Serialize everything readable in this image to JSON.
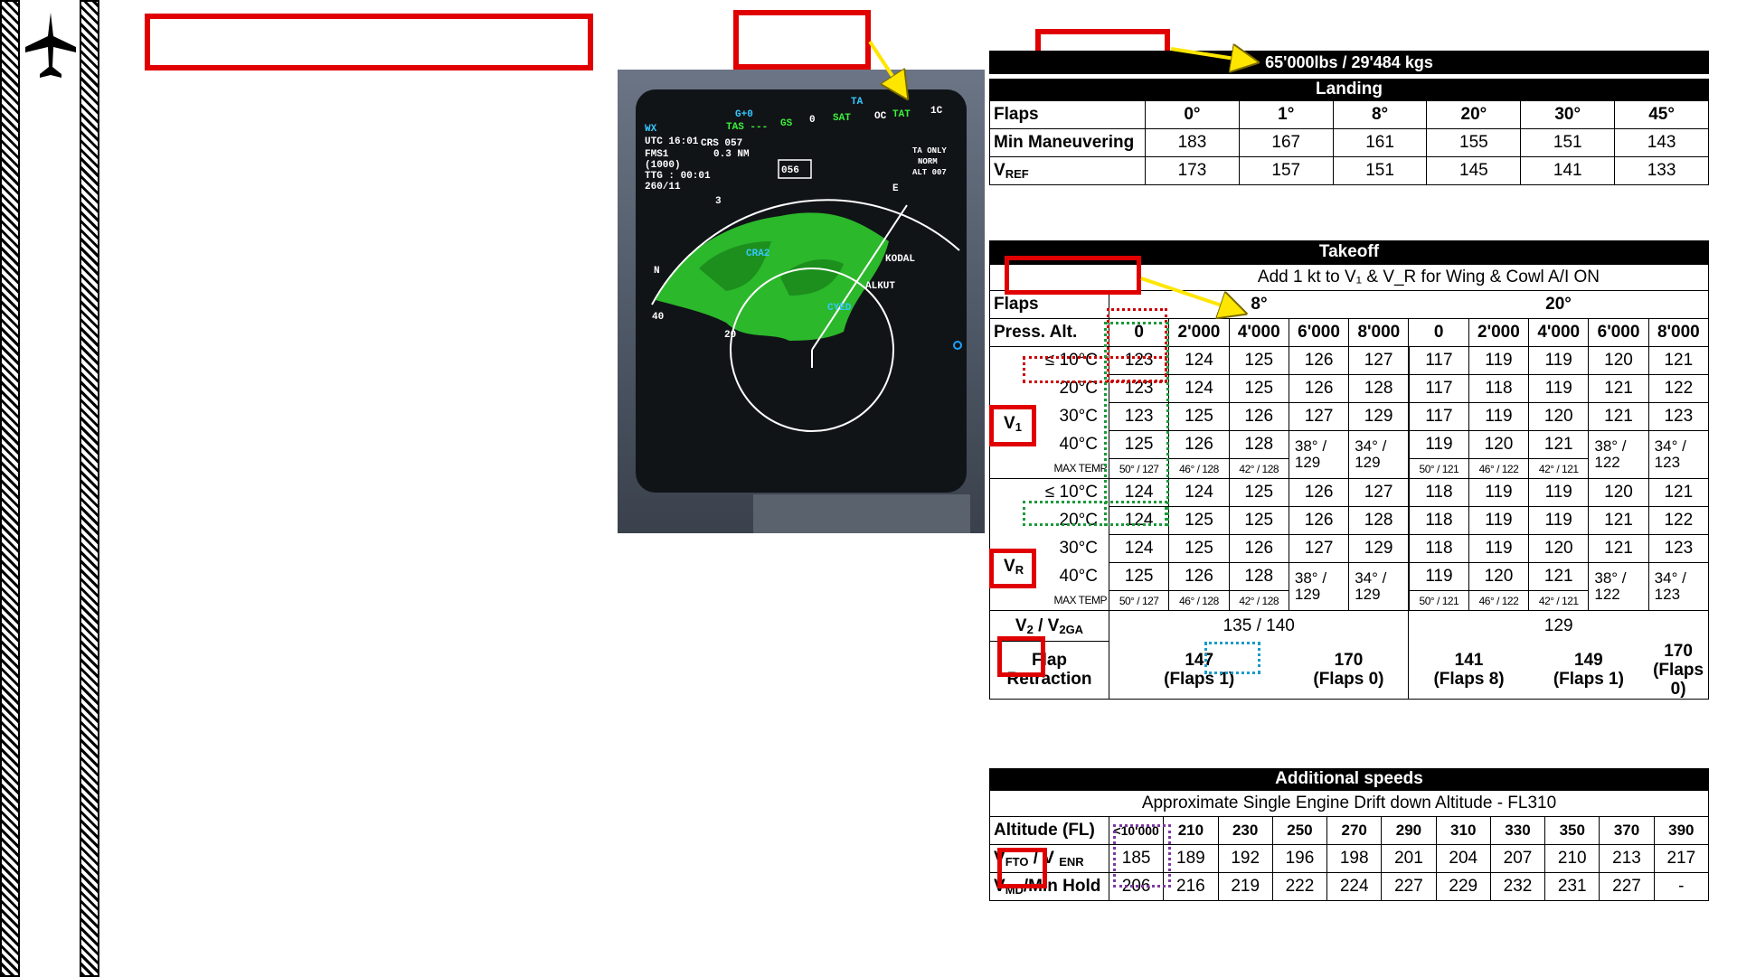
{
  "colors": {
    "callout_red": "#e00000",
    "arrow_yellow": "#ffe600",
    "radar_green": "#2bb82b"
  },
  "icons": [
    "airplane-icon"
  ],
  "radar": {
    "wx": "WX",
    "utc": "UTC 16:01",
    "fms": "FMS1",
    "fms_alt": "(1000)",
    "ttg": "TTG : 00:01",
    "range": "260/11",
    "crs": "CRS 057",
    "nm": "0.3 NM",
    "g0": "G+0",
    "tas": "TAS ---",
    "gs": "GS",
    "zero": "0",
    "sat": "SAT",
    "oc": "OC",
    "ta": "TA",
    "tat": "TAT",
    "temp": "1C",
    "ta_only": "TA ONLY",
    "norm": "NORM",
    "alt007": "ALT 007",
    "heading": "056",
    "fix_cra2": "CRA2",
    "fix_kodal": "KODAL",
    "fix_alkut": "ALKUT",
    "fix_cyed": "CYED",
    "ring40": "40",
    "ring20": "20",
    "n_label": "N",
    "e_label": "E",
    "three_label": "3"
  },
  "weight": {
    "text": "65'000lbs / 29'484 kgs"
  },
  "landing": {
    "title": "Landing",
    "flaps_label": "Flaps",
    "flaps": [
      "0°",
      "1°",
      "8°",
      "20°",
      "30°",
      "45°"
    ],
    "min_man_label": "Min Maneuvering",
    "min_man": [
      "183",
      "167",
      "161",
      "155",
      "151",
      "143"
    ],
    "vref_label": "V",
    "vref_sub": "REF",
    "vref": [
      "173",
      "157",
      "151",
      "145",
      "141",
      "133"
    ]
  },
  "takeoff": {
    "title": "Takeoff",
    "note": "Add 1 kt to V₁ & V_R for Wing & Cowl A/I ON",
    "flaps_label": "Flaps",
    "flaps8": "8°",
    "flaps20": "20°",
    "press_alt_label": "Press. Alt.",
    "alts": [
      "0",
      "2'000",
      "4'000",
      "6'000",
      "8'000",
      "0",
      "2'000",
      "4'000",
      "6'000",
      "8'000"
    ],
    "temps": [
      "≤ 10°C",
      "20°C",
      "30°C",
      "40°C",
      "MAX TEMP"
    ],
    "v1_label": "V",
    "v1_sub": "1",
    "vr_label": "V",
    "vr_sub": "R",
    "v1_rows": [
      [
        "123",
        "124",
        "125",
        "126",
        "127",
        "117",
        "119",
        "119",
        "120",
        "121"
      ],
      [
        "123",
        "124",
        "125",
        "126",
        "128",
        "117",
        "118",
        "119",
        "121",
        "122"
      ],
      [
        "123",
        "125",
        "126",
        "127",
        "129",
        "117",
        "119",
        "120",
        "121",
        "123"
      ],
      [
        "125",
        "126",
        "128",
        "38° / 129",
        "34° / 129",
        "119",
        "120",
        "121",
        "38° / 122",
        "34° / 123"
      ],
      [
        "50° / 127",
        "46° / 128",
        "42° / 128",
        "",
        "",
        "50° / 121",
        "46° / 122",
        "42° / 121",
        "",
        ""
      ]
    ],
    "vr_rows": [
      [
        "124",
        "124",
        "125",
        "126",
        "127",
        "118",
        "119",
        "119",
        "120",
        "121"
      ],
      [
        "124",
        "125",
        "125",
        "126",
        "128",
        "118",
        "119",
        "119",
        "121",
        "122"
      ],
      [
        "124",
        "125",
        "126",
        "127",
        "129",
        "118",
        "119",
        "120",
        "121",
        "123"
      ],
      [
        "125",
        "126",
        "128",
        "38° / 129",
        "34° / 129",
        "119",
        "120",
        "121",
        "38° / 122",
        "34° / 123"
      ],
      [
        "50° / 127",
        "46° / 128",
        "42° / 128",
        "",
        "",
        "50° / 121",
        "46° / 122",
        "42° / 121",
        "",
        ""
      ]
    ],
    "v2_label": "V",
    "v2_sub": "2",
    "v2ga_label": " / V",
    "v2ga_sub": "2GA",
    "v2_8": "135 / 140",
    "v2_20": "129",
    "flap_ret_label": "Flap Retraction",
    "flap_ret": [
      {
        "speed": "147",
        "flaps": "(Flaps 1)"
      },
      {
        "speed": "170",
        "flaps": "(Flaps 0)"
      },
      {
        "speed": "141",
        "flaps": "(Flaps 8)"
      },
      {
        "speed": "149",
        "flaps": "(Flaps 1)"
      },
      {
        "speed": "170",
        "flaps": "(Flaps 0)"
      }
    ]
  },
  "additional": {
    "title": "Additional speeds",
    "subtitle": "Approximate Single Engine Drift down Altitude - FL310",
    "alt_label": "Altitude (FL)",
    "alts": [
      "<10'000",
      "210",
      "230",
      "250",
      "270",
      "290",
      "310",
      "330",
      "350",
      "370",
      "390"
    ],
    "vfto_label": "V",
    "vfto_sub": "FTO",
    "venr_label": " / V ",
    "venr_sub": "ENR",
    "vfto": [
      "185",
      "189",
      "192",
      "196",
      "198",
      "201",
      "204",
      "207",
      "210",
      "213",
      "217"
    ],
    "vmd_label": "V",
    "vmd_sub": "MD",
    "vmd_rest": "/Min Hold",
    "vmd": [
      "206",
      "216",
      "219",
      "222",
      "224",
      "227",
      "229",
      "232",
      "231",
      "227",
      "-"
    ]
  }
}
